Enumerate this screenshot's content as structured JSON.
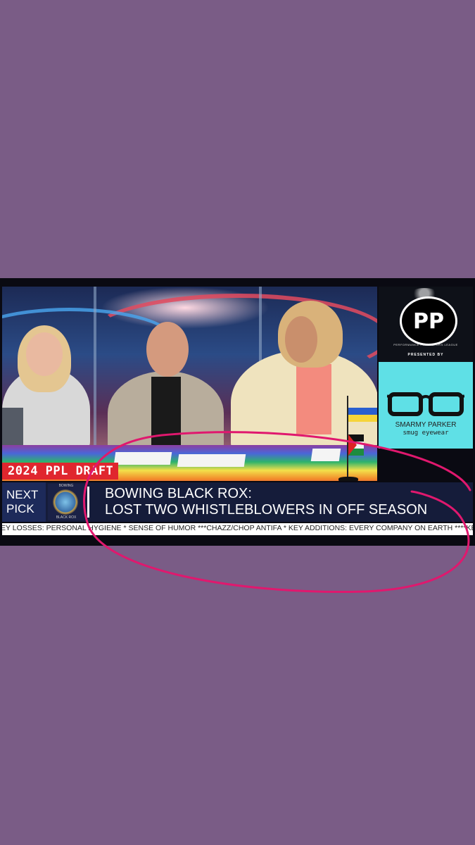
{
  "overlay": {
    "draft_tag": "2024 PPL DRAFT",
    "next_pick": "NEXT PICK",
    "team_logo_top": "BOWING",
    "team_logo_bottom": "BLACK ROX",
    "headline_line1": "BOWING BLACK ROX:",
    "headline_line2": "LOST TWO WHISTLEBLOWERS IN OFF SEASON",
    "ticker": "EY LOSSES: PERSONAL HYGIENE * SENSE OF HUMOR ***CHAZZ/CHOP ANTIFA * KEY ADDITIONS: EVERY COMPANY ON EARTH ****KEY LOSSE"
  },
  "sidebar": {
    "logo_letters": "PP",
    "logo_subtitle": "PERFORMANCE PROTESTORS LEAGUE",
    "presented_by": "PRESENTED BY",
    "ad_brand": "SMARMY PARKER",
    "ad_tagline": "smug eyewear"
  },
  "colors": {
    "background": "#7a5c86",
    "draft_red": "#e0262e",
    "lower_bar": "#151c3a",
    "ad_cyan": "#5fe0e6",
    "annotation_pink": "#e0186e"
  }
}
